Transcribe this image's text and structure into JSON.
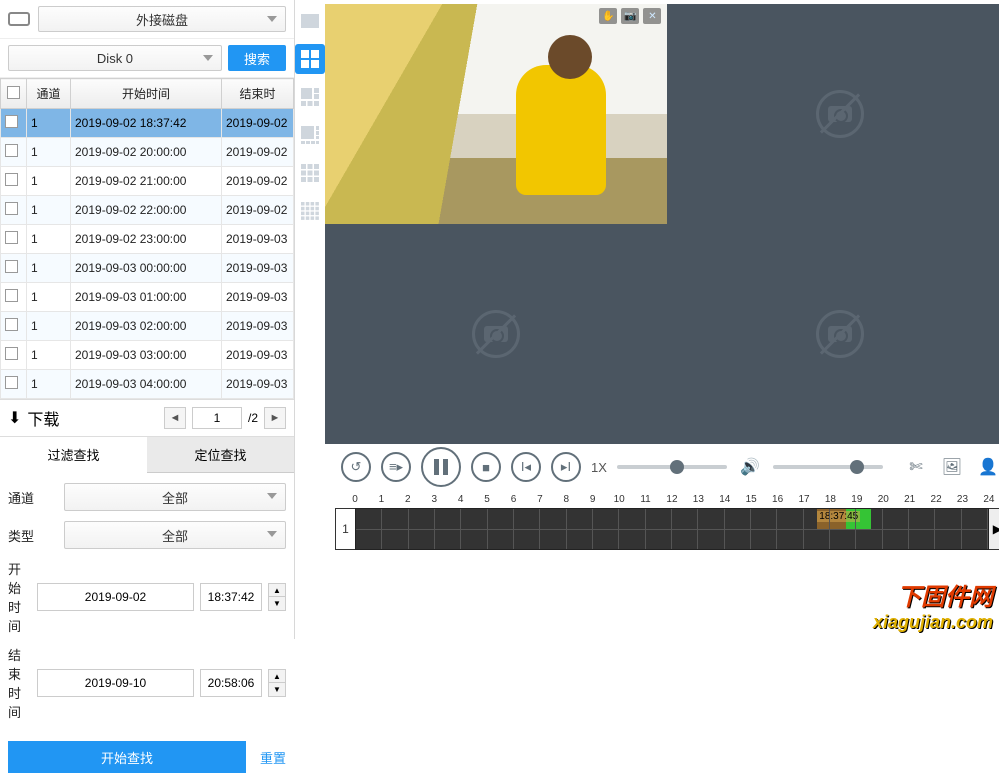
{
  "disk": {
    "type_label": "外接磁盘",
    "selected": "Disk 0",
    "search_btn": "搜索"
  },
  "table": {
    "headers": [
      "",
      "通道",
      "开始时间",
      "结束时间"
    ],
    "rows": [
      {
        "ch": "1",
        "start": "2019-09-02 18:37:42",
        "end": "2019-09-02",
        "selected": true
      },
      {
        "ch": "1",
        "start": "2019-09-02 20:00:00",
        "end": "2019-09-02"
      },
      {
        "ch": "1",
        "start": "2019-09-02 21:00:00",
        "end": "2019-09-02"
      },
      {
        "ch": "1",
        "start": "2019-09-02 22:00:00",
        "end": "2019-09-02"
      },
      {
        "ch": "1",
        "start": "2019-09-02 23:00:00",
        "end": "2019-09-03"
      },
      {
        "ch": "1",
        "start": "2019-09-03 00:00:00",
        "end": "2019-09-03"
      },
      {
        "ch": "1",
        "start": "2019-09-03 01:00:00",
        "end": "2019-09-03"
      },
      {
        "ch": "1",
        "start": "2019-09-03 02:00:00",
        "end": "2019-09-03"
      },
      {
        "ch": "1",
        "start": "2019-09-03 03:00:00",
        "end": "2019-09-03"
      },
      {
        "ch": "1",
        "start": "2019-09-03 04:00:00",
        "end": "2019-09-03"
      }
    ]
  },
  "download": {
    "label": "下载",
    "page": "1",
    "total": "/2"
  },
  "tabs": {
    "filter": "过滤查找",
    "locate": "定位查找"
  },
  "filter": {
    "channel_lbl": "通道",
    "channel_val": "全部",
    "type_lbl": "类型",
    "type_val": "全部",
    "start_lbl": "开始时间",
    "start_date": "2019-09-02",
    "start_time": "18:37:42",
    "end_lbl": "结束时间",
    "end_date": "2019-09-10",
    "end_time": "20:58:06",
    "search_btn": "开始查找",
    "reset": "重置"
  },
  "playback": {
    "speed": "1X"
  },
  "timeline": {
    "row_label": "1",
    "cursor_time": "18:37:45",
    "hours": [
      "0",
      "1",
      "2",
      "3",
      "4",
      "5",
      "6",
      "7",
      "8",
      "9",
      "10",
      "11",
      "12",
      "13",
      "14",
      "15",
      "16",
      "17",
      "18",
      "19",
      "20",
      "21",
      "22",
      "23",
      "24"
    ]
  },
  "watermark": {
    "line1": "下固件网",
    "line2": "xiagujian.com"
  }
}
